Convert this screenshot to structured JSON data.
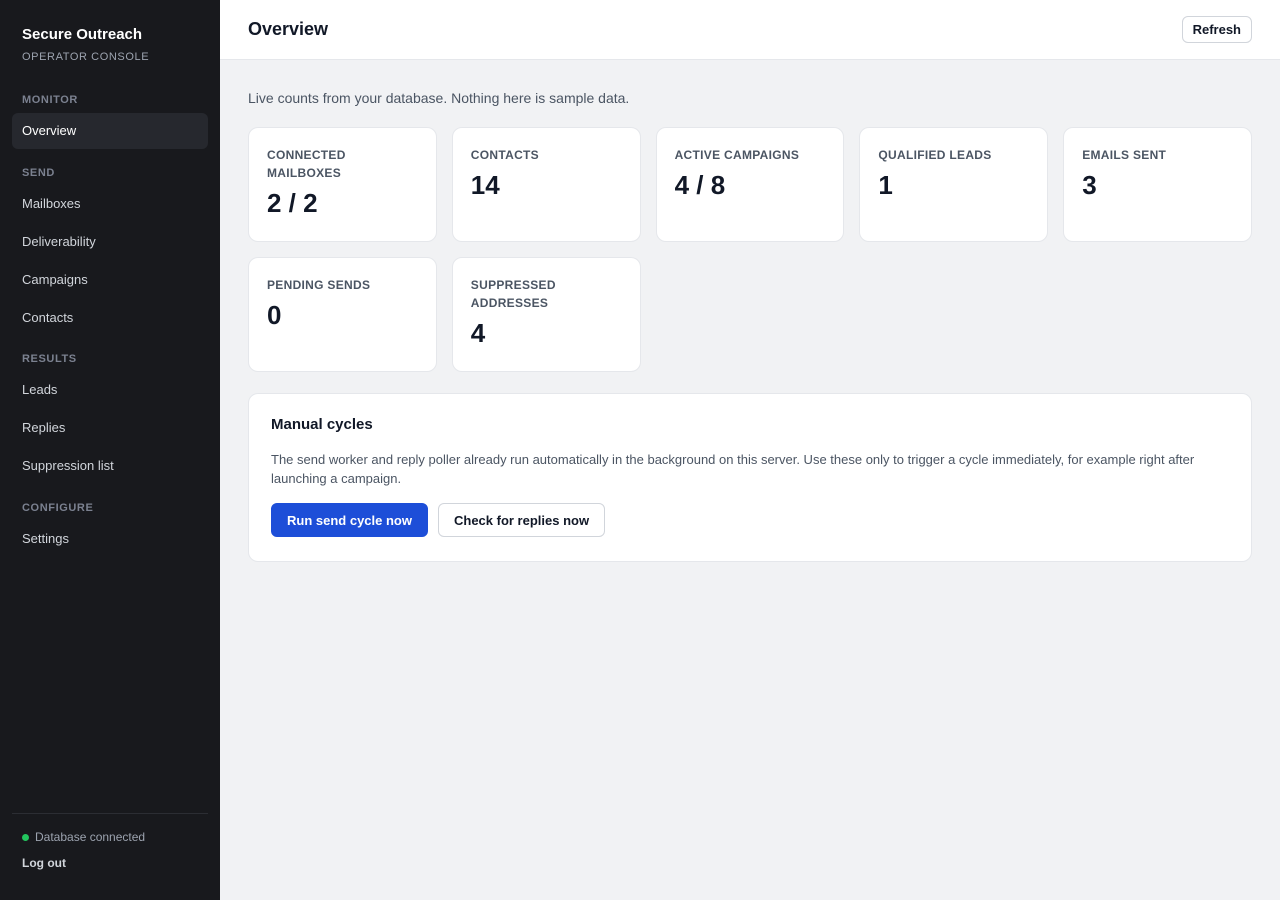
{
  "sidebar": {
    "brand_title": "Secure Outreach",
    "brand_subtitle": "OPERATOR CONSOLE",
    "sections": {
      "monitor": "MONITOR",
      "send": "SEND",
      "results": "RESULTS",
      "configure": "CONFIGURE"
    },
    "items": {
      "overview": "Overview",
      "mailboxes": "Mailboxes",
      "deliverability": "Deliverability",
      "campaigns": "Campaigns",
      "contacts": "Contacts",
      "leads": "Leads",
      "replies": "Replies",
      "suppression": "Suppression list",
      "settings": "Settings"
    },
    "active_item": "Overview",
    "status": {
      "text": "Database connected",
      "color": "#22c55e"
    },
    "logout": "Log out"
  },
  "header": {
    "title": "Overview",
    "refresh_label": "Refresh"
  },
  "main": {
    "intro": "Live counts from your database. Nothing here is sample data.",
    "stats": [
      {
        "label": "CONNECTED MAILBOXES",
        "value": "2 / 2"
      },
      {
        "label": "CONTACTS",
        "value": "14"
      },
      {
        "label": "ACTIVE CAMPAIGNS",
        "value": "4 / 8"
      },
      {
        "label": "QUALIFIED LEADS",
        "value": "1"
      },
      {
        "label": "EMAILS SENT",
        "value": "3"
      },
      {
        "label": "PENDING SENDS",
        "value": "0"
      },
      {
        "label": "SUPPRESSED ADDRESSES",
        "value": "4"
      }
    ],
    "manual": {
      "title": "Manual cycles",
      "description": "The send worker and reply poller already run automatically in the background on this server. Use these only to trigger a cycle immediately, for example right after launching a campaign.",
      "run_label": "Run send cycle now",
      "check_label": "Check for replies now"
    }
  },
  "colors": {
    "sidebar_bg": "#18191d",
    "accent": "#1d4ed8",
    "status_ok": "#22c55e"
  }
}
